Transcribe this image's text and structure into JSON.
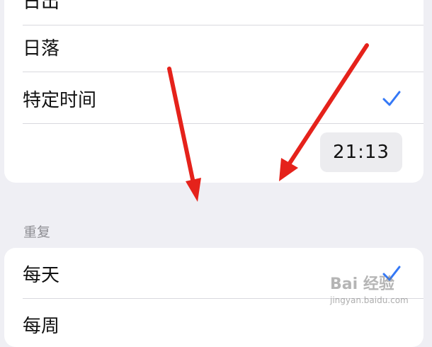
{
  "schedule_options": {
    "sunrise_label": "日出",
    "sunset_label": "日落",
    "custom_time_label": "特定时间",
    "custom_time_selected": true,
    "time_value": "21:13"
  },
  "repeat_section": {
    "header": "重复",
    "every_day_label": "每天",
    "every_day_selected": true,
    "weekday_label": "每周"
  },
  "watermark": {
    "logo": "Bai 经验",
    "url": "jingyan.baidu.com"
  },
  "colors": {
    "check": "#3478f6",
    "annotation_arrow": "#e5221b",
    "background": "#efeff4"
  }
}
